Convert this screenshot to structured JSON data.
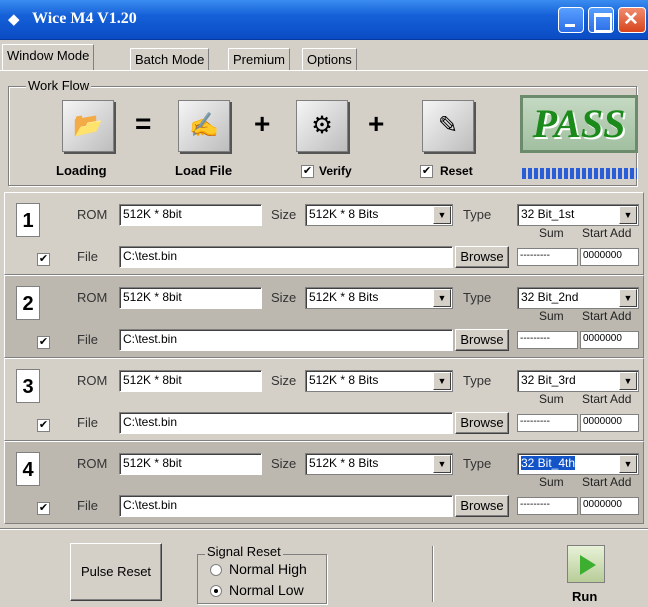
{
  "window": {
    "title": "Wice M4 V1.20",
    "icon": "diamond-app-icon"
  },
  "tabs": [
    {
      "label": "Window Mode",
      "active": true
    },
    {
      "label": "Batch Mode",
      "active": false
    },
    {
      "label": "Premium",
      "active": false
    },
    {
      "label": "Options",
      "active": false
    }
  ],
  "workflow": {
    "legend": "Work Flow",
    "loading_label": "Loading",
    "loadfile_label": "Load File",
    "verify_label": "Verify",
    "verify_checked": true,
    "reset_label": "Reset",
    "reset_checked": true,
    "equals": "=",
    "plus": "+",
    "pass_text": "PASS"
  },
  "rows": [
    {
      "num": "1",
      "rom_label": "ROM",
      "rom": "512K * 8bit",
      "size_label": "Size",
      "size": "512K * 8 Bits",
      "type_label": "Type",
      "type": "32 Bit_1st",
      "file_label": "File",
      "file": "C:\\test.bin",
      "browse": "Browse",
      "sum_label": "Sum",
      "start_label": "Start Add",
      "sum": "---------",
      "start": "0000000",
      "checked": true,
      "selected": false
    },
    {
      "num": "2",
      "rom_label": "ROM",
      "rom": "512K * 8bit",
      "size_label": "Size",
      "size": "512K * 8 Bits",
      "type_label": "Type",
      "type": "32 Bit_2nd",
      "file_label": "File",
      "file": "C:\\test.bin",
      "browse": "Browse",
      "sum_label": "Sum",
      "start_label": "Start Add",
      "sum": "---------",
      "start": "0000000",
      "checked": true,
      "selected": false
    },
    {
      "num": "3",
      "rom_label": "ROM",
      "rom": "512K * 8bit",
      "size_label": "Size",
      "size": "512K * 8 Bits",
      "type_label": "Type",
      "type": "32 Bit_3rd",
      "file_label": "File",
      "file": "C:\\test.bin",
      "browse": "Browse",
      "sum_label": "Sum",
      "start_label": "Start Add",
      "sum": "---------",
      "start": "0000000",
      "checked": true,
      "selected": false
    },
    {
      "num": "4",
      "rom_label": "ROM",
      "rom": "512K * 8bit",
      "size_label": "Size",
      "size": "512K * 8 Bits",
      "type_label": "Type",
      "type": "32 Bit_4th",
      "file_label": "File",
      "file": "C:\\test.bin",
      "browse": "Browse",
      "sum_label": "Sum",
      "start_label": "Start Add",
      "sum": "---------",
      "start": "0000000",
      "checked": true,
      "selected": true
    }
  ],
  "bottom": {
    "pulse_reset": "Pulse Reset",
    "signal_legend": "Signal Reset",
    "normal_high": "Normal High",
    "normal_low": "Normal Low",
    "selected_signal": "Normal Low",
    "run": "Run"
  }
}
